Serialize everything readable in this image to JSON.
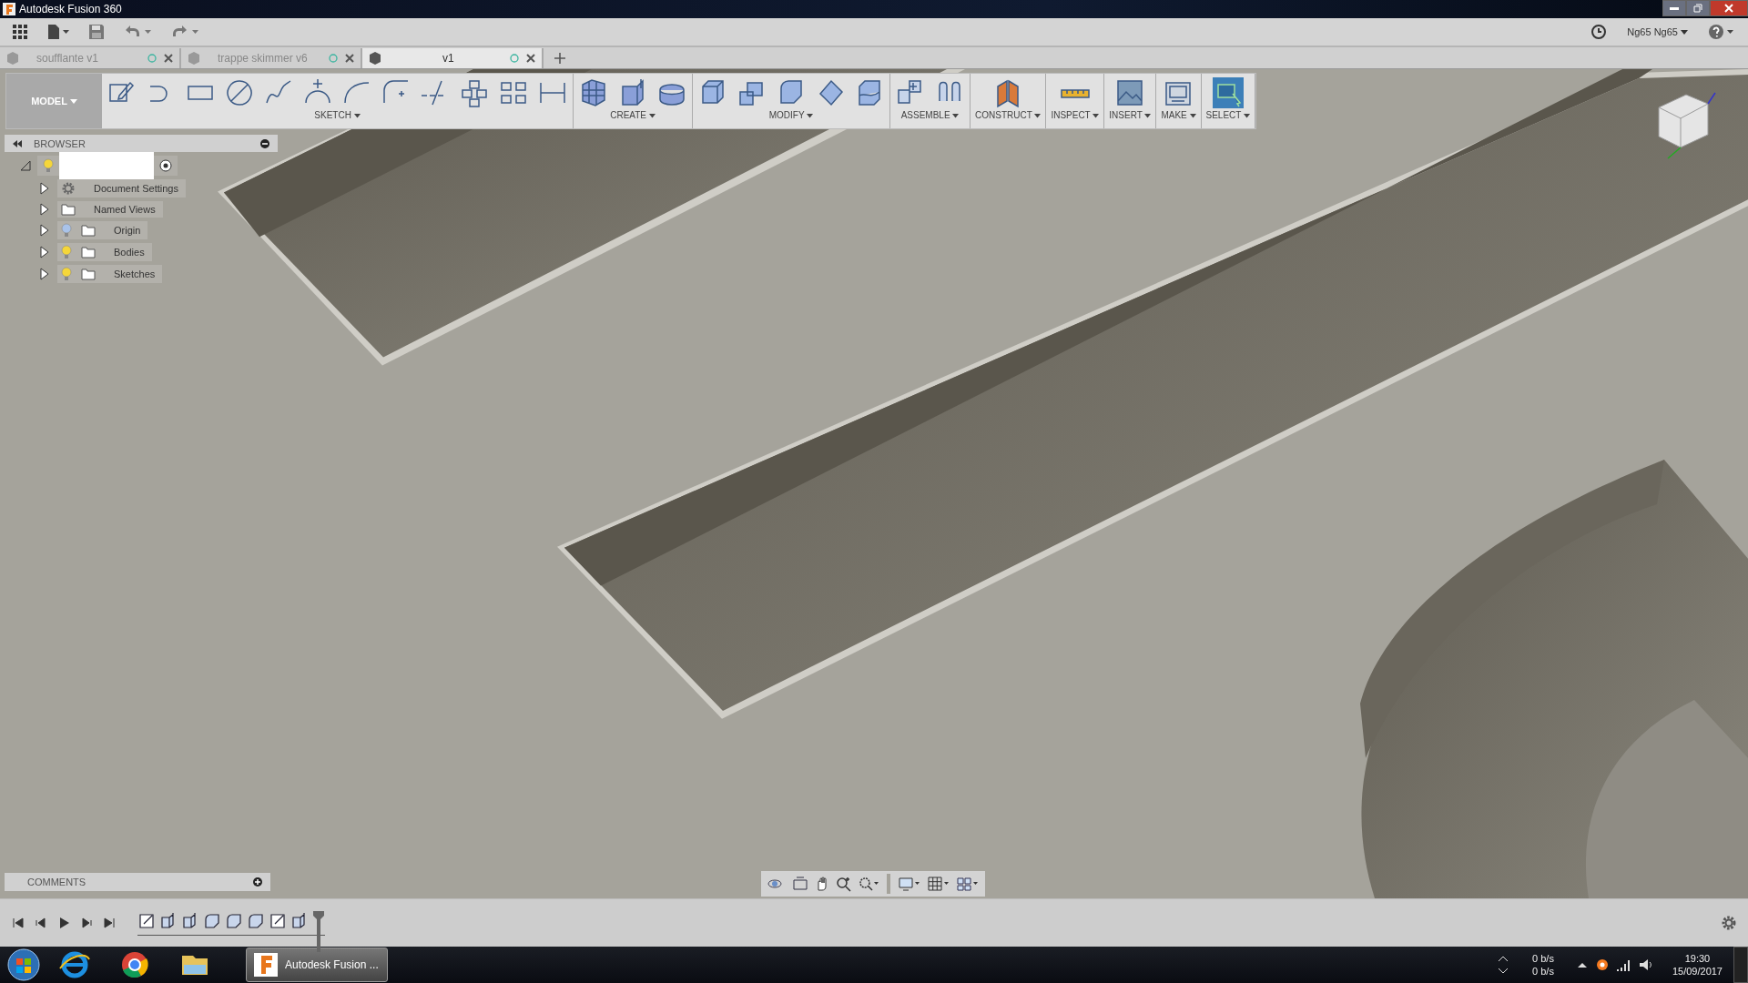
{
  "window": {
    "title": "Autodesk Fusion 360"
  },
  "user": {
    "name": "Ng65 Ng65"
  },
  "tabs": [
    {
      "label": "soufflante v1",
      "selected": false
    },
    {
      "label": "trappe skimmer v6",
      "selected": false
    },
    {
      "label": "v1",
      "selected": true
    }
  ],
  "toolbar": {
    "workspace": "MODEL",
    "groups": [
      {
        "kind": "sketch",
        "label": "SKETCH"
      },
      {
        "kind": "create",
        "label": "CREATE"
      },
      {
        "kind": "modify",
        "label": "MODIFY"
      },
      {
        "kind": "assemble",
        "label": "ASSEMBLE"
      },
      {
        "kind": "construct",
        "label": "CONSTRUCT"
      },
      {
        "kind": "inspect",
        "label": "INSPECT"
      },
      {
        "kind": "insert",
        "label": "INSERT"
      },
      {
        "kind": "make",
        "label": "MAKE"
      },
      {
        "kind": "select",
        "label": "SELECT"
      }
    ]
  },
  "browser": {
    "title": "BROWSER",
    "root": {
      "expanded": true,
      "visible": true,
      "children": [
        {
          "kind": "settings",
          "label": "Document Settings",
          "expanded": false
        },
        {
          "kind": "folder",
          "label": "Named Views",
          "expanded": false
        },
        {
          "kind": "folder",
          "label": "Origin",
          "visible": false,
          "expanded": false
        },
        {
          "kind": "folder",
          "label": "Bodies",
          "visible": true,
          "expanded": false
        },
        {
          "kind": "folder",
          "label": "Sketches",
          "visible": true,
          "expanded": false
        }
      ]
    }
  },
  "comments": {
    "title": "COMMENTS"
  },
  "timeline": {
    "steps": [
      {
        "kind": "sketch"
      },
      {
        "kind": "extrude"
      },
      {
        "kind": "extrude"
      },
      {
        "kind": "fillet"
      },
      {
        "kind": "fillet"
      },
      {
        "kind": "fillet"
      },
      {
        "kind": "sketch"
      },
      {
        "kind": "extrude"
      }
    ]
  },
  "taskbar": {
    "active_app": "Autodesk Fusion ...",
    "net_up": "0 b/s",
    "net_down": "0 b/s",
    "time": "19:30",
    "date": "15/09/2017"
  }
}
